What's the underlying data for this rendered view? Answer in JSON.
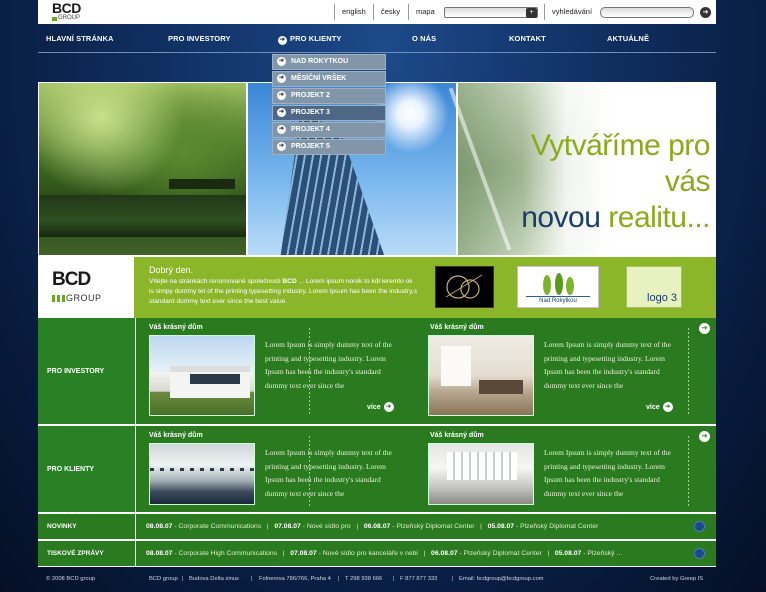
{
  "topbar": {
    "logo": {
      "word": "BCD",
      "sub": "GROUP"
    },
    "lang_en": "english",
    "lang_cz": "česky",
    "map_label": "mapa",
    "map_value": "",
    "search_label": "vyhledávání",
    "search_value": ""
  },
  "nav": {
    "home": "HLAVNÍ STRÁNKA",
    "investors": "PRO INVESTORY",
    "clients": "PRO KLIENTY",
    "about": "O NÁS",
    "contact": "KONTAKT",
    "news": "AKTUÁLNĚ"
  },
  "dropdown": [
    "NAD ROKYTKOU",
    "MĚSÍČNÍ VRŠEK",
    "PROJEKT 2",
    "PROJEKT 3",
    "PROJEKT 4",
    "PROJEKT 5"
  ],
  "hero": {
    "line1": "Vytváříme pro vás",
    "line2a": "novou",
    "line2b": "realitu..."
  },
  "intro": {
    "logo_word": "BCD",
    "logo_sub": "GROUP",
    "greeting": "Dobrý den.",
    "text_pre": "Vítejte na stránkách renomované společnosti ",
    "text_brand": "BCD",
    "text_post": " ... Lorem ipsum norek to kdl leremto ok is simpy dummy tet of the printing typesetting industry. Lorem Ipsum has been the industry,s standard dummy text ever since the best value.",
    "partner2": "Nad Rokytkou",
    "partner3": "logo 3"
  },
  "sections": [
    {
      "label": "PRO INVESTORY",
      "cards": [
        {
          "title": "Váš krásný dům",
          "text": "Lorem Ipsum is simply dummy text of the printing and typesetting industry. Lorem Ipsum has been the industry's standard dummy text ever since the",
          "more": "více"
        },
        {
          "title": "Váš krásný dům",
          "text": "Lorem Ipsum is simply dummy text of the printing and typesetting industry. Lorem Ipsum has been the industry's standard dummy text ever since the",
          "more": "více"
        }
      ]
    },
    {
      "label": "PRO KLIENTY",
      "cards": [
        {
          "title": "Váš krásný dům",
          "text": "Lorem Ipsum is simply dummy text of the printing and typesetting industry. Lorem Ipsum has been the industry's standard dummy text ever since the",
          "more": ""
        },
        {
          "title": "Váš krásný dům",
          "text": "Lorem Ipsum is simply dummy text of the printing and typesetting industry. Lorem Ipsum has been the industry's standard dummy text ever since the",
          "more": ""
        }
      ]
    }
  ],
  "news": [
    {
      "label": "NOVINKY",
      "items": [
        {
          "date": "08.08.07",
          "text": " - Corporate Communications"
        },
        {
          "date": "07.08.07",
          "text": " - Nové sídlo pro"
        },
        {
          "date": "06.08.07",
          "text": " - Plzeňský Diplomat Center"
        },
        {
          "date": "05.08.07",
          "text": " - Plzeňský Diplomat Center"
        }
      ]
    },
    {
      "label": "TISKOVÉ ZPRÁVY",
      "items": [
        {
          "date": "08.08.07",
          "text": " - Corporate High Communications"
        },
        {
          "date": "07.08.07",
          "text": " - Nové sídlo pro kanceláře v nebi"
        },
        {
          "date": "06.08.07",
          "text": " - Plzeňský Diplomat Center"
        },
        {
          "date": "05.08.07",
          "text": " - Plzeňský ..."
        }
      ]
    }
  ],
  "footer": {
    "copyright": "© 2008  BCD group",
    "company": "BCD group",
    "building": "Budova Delta  sinus",
    "address": "Folnerova 786/766, Praha 4",
    "phone": "T  298 938 666",
    "fax": "F  877 877 333",
    "email": "Email: bcdgroup@bcdgroup.com",
    "credit": "Created  by Greep IS"
  },
  "colors": {
    "green": "#2a7a20",
    "lime": "#8bb62a",
    "navy": "#103062",
    "slogan_green": "#8aaa1c",
    "slogan_dark": "#1a3d6a"
  },
  "icons": [
    "arrow-right-icon",
    "arrow-circle-icon",
    "search-go-icon"
  ]
}
